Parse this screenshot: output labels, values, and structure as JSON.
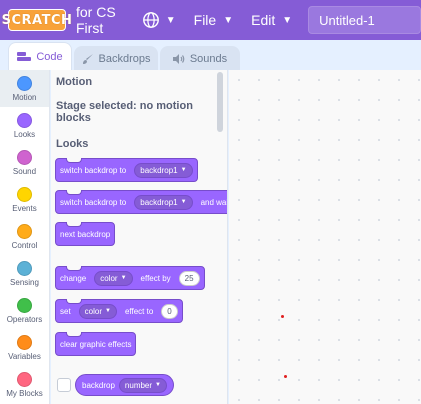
{
  "menubar": {
    "logo_text": "SCRATCH",
    "subtitle": "for CS First",
    "file_label": "File",
    "edit_label": "Edit",
    "project_title": "Untitled-1"
  },
  "tabs": {
    "code": "Code",
    "backdrops": "Backdrops",
    "sounds": "Sounds"
  },
  "categories": [
    {
      "label": "Motion",
      "color": "#4c97ff"
    },
    {
      "label": "Looks",
      "color": "#9966ff"
    },
    {
      "label": "Sound",
      "color": "#cf63cf"
    },
    {
      "label": "Events",
      "color": "#ffd500"
    },
    {
      "label": "Control",
      "color": "#ffab19"
    },
    {
      "label": "Sensing",
      "color": "#5cb1d6"
    },
    {
      "label": "Operators",
      "color": "#40bf4a"
    },
    {
      "label": "Variables",
      "color": "#ff8c1a"
    },
    {
      "label": "My Blocks",
      "color": "#ff6680"
    }
  ],
  "palette": {
    "motion_title": "Motion",
    "motion_note": "Stage selected: no motion blocks",
    "looks_title": "Looks",
    "b1_text": "switch backdrop to",
    "b1_value": "backdrop1",
    "b2_text": "switch backdrop to",
    "b2_value": "backdrop1",
    "b2_suffix": "and wait",
    "b3_text": "next backdrop",
    "b4_text": "change",
    "b4_value": "color",
    "b4_mid": "effect by",
    "b4_num": "25",
    "b5_text": "set",
    "b5_value": "color",
    "b5_mid": "effect to",
    "b5_num": "0",
    "b6_text": "clear graphic effects",
    "b7_text": "backdrop",
    "b7_value": "number"
  },
  "colors": {
    "menubar": "#855cd6",
    "looks": "#9966ff",
    "accent": "#855cd6"
  }
}
